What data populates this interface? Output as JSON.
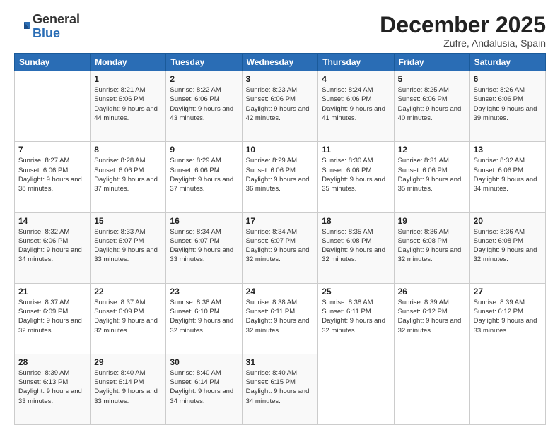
{
  "logo": {
    "general": "General",
    "blue": "Blue"
  },
  "header": {
    "month": "December 2025",
    "location": "Zufre, Andalusia, Spain"
  },
  "weekdays": [
    "Sunday",
    "Monday",
    "Tuesday",
    "Wednesday",
    "Thursday",
    "Friday",
    "Saturday"
  ],
  "weeks": [
    [
      {
        "day": "",
        "info": ""
      },
      {
        "day": "1",
        "info": "Sunrise: 8:21 AM\nSunset: 6:06 PM\nDaylight: 9 hours\nand 44 minutes."
      },
      {
        "day": "2",
        "info": "Sunrise: 8:22 AM\nSunset: 6:06 PM\nDaylight: 9 hours\nand 43 minutes."
      },
      {
        "day": "3",
        "info": "Sunrise: 8:23 AM\nSunset: 6:06 PM\nDaylight: 9 hours\nand 42 minutes."
      },
      {
        "day": "4",
        "info": "Sunrise: 8:24 AM\nSunset: 6:06 PM\nDaylight: 9 hours\nand 41 minutes."
      },
      {
        "day": "5",
        "info": "Sunrise: 8:25 AM\nSunset: 6:06 PM\nDaylight: 9 hours\nand 40 minutes."
      },
      {
        "day": "6",
        "info": "Sunrise: 8:26 AM\nSunset: 6:06 PM\nDaylight: 9 hours\nand 39 minutes."
      }
    ],
    [
      {
        "day": "7",
        "info": "Sunrise: 8:27 AM\nSunset: 6:06 PM\nDaylight: 9 hours\nand 38 minutes."
      },
      {
        "day": "8",
        "info": "Sunrise: 8:28 AM\nSunset: 6:06 PM\nDaylight: 9 hours\nand 37 minutes."
      },
      {
        "day": "9",
        "info": "Sunrise: 8:29 AM\nSunset: 6:06 PM\nDaylight: 9 hours\nand 37 minutes."
      },
      {
        "day": "10",
        "info": "Sunrise: 8:29 AM\nSunset: 6:06 PM\nDaylight: 9 hours\nand 36 minutes."
      },
      {
        "day": "11",
        "info": "Sunrise: 8:30 AM\nSunset: 6:06 PM\nDaylight: 9 hours\nand 35 minutes."
      },
      {
        "day": "12",
        "info": "Sunrise: 8:31 AM\nSunset: 6:06 PM\nDaylight: 9 hours\nand 35 minutes."
      },
      {
        "day": "13",
        "info": "Sunrise: 8:32 AM\nSunset: 6:06 PM\nDaylight: 9 hours\nand 34 minutes."
      }
    ],
    [
      {
        "day": "14",
        "info": "Sunrise: 8:32 AM\nSunset: 6:06 PM\nDaylight: 9 hours\nand 34 minutes."
      },
      {
        "day": "15",
        "info": "Sunrise: 8:33 AM\nSunset: 6:07 PM\nDaylight: 9 hours\nand 33 minutes."
      },
      {
        "day": "16",
        "info": "Sunrise: 8:34 AM\nSunset: 6:07 PM\nDaylight: 9 hours\nand 33 minutes."
      },
      {
        "day": "17",
        "info": "Sunrise: 8:34 AM\nSunset: 6:07 PM\nDaylight: 9 hours\nand 32 minutes."
      },
      {
        "day": "18",
        "info": "Sunrise: 8:35 AM\nSunset: 6:08 PM\nDaylight: 9 hours\nand 32 minutes."
      },
      {
        "day": "19",
        "info": "Sunrise: 8:36 AM\nSunset: 6:08 PM\nDaylight: 9 hours\nand 32 minutes."
      },
      {
        "day": "20",
        "info": "Sunrise: 8:36 AM\nSunset: 6:08 PM\nDaylight: 9 hours\nand 32 minutes."
      }
    ],
    [
      {
        "day": "21",
        "info": "Sunrise: 8:37 AM\nSunset: 6:09 PM\nDaylight: 9 hours\nand 32 minutes."
      },
      {
        "day": "22",
        "info": "Sunrise: 8:37 AM\nSunset: 6:09 PM\nDaylight: 9 hours\nand 32 minutes."
      },
      {
        "day": "23",
        "info": "Sunrise: 8:38 AM\nSunset: 6:10 PM\nDaylight: 9 hours\nand 32 minutes."
      },
      {
        "day": "24",
        "info": "Sunrise: 8:38 AM\nSunset: 6:11 PM\nDaylight: 9 hours\nand 32 minutes."
      },
      {
        "day": "25",
        "info": "Sunrise: 8:38 AM\nSunset: 6:11 PM\nDaylight: 9 hours\nand 32 minutes."
      },
      {
        "day": "26",
        "info": "Sunrise: 8:39 AM\nSunset: 6:12 PM\nDaylight: 9 hours\nand 32 minutes."
      },
      {
        "day": "27",
        "info": "Sunrise: 8:39 AM\nSunset: 6:12 PM\nDaylight: 9 hours\nand 33 minutes."
      }
    ],
    [
      {
        "day": "28",
        "info": "Sunrise: 8:39 AM\nSunset: 6:13 PM\nDaylight: 9 hours\nand 33 minutes."
      },
      {
        "day": "29",
        "info": "Sunrise: 8:40 AM\nSunset: 6:14 PM\nDaylight: 9 hours\nand 33 minutes."
      },
      {
        "day": "30",
        "info": "Sunrise: 8:40 AM\nSunset: 6:14 PM\nDaylight: 9 hours\nand 34 minutes."
      },
      {
        "day": "31",
        "info": "Sunrise: 8:40 AM\nSunset: 6:15 PM\nDaylight: 9 hours\nand 34 minutes."
      },
      {
        "day": "",
        "info": ""
      },
      {
        "day": "",
        "info": ""
      },
      {
        "day": "",
        "info": ""
      }
    ]
  ]
}
